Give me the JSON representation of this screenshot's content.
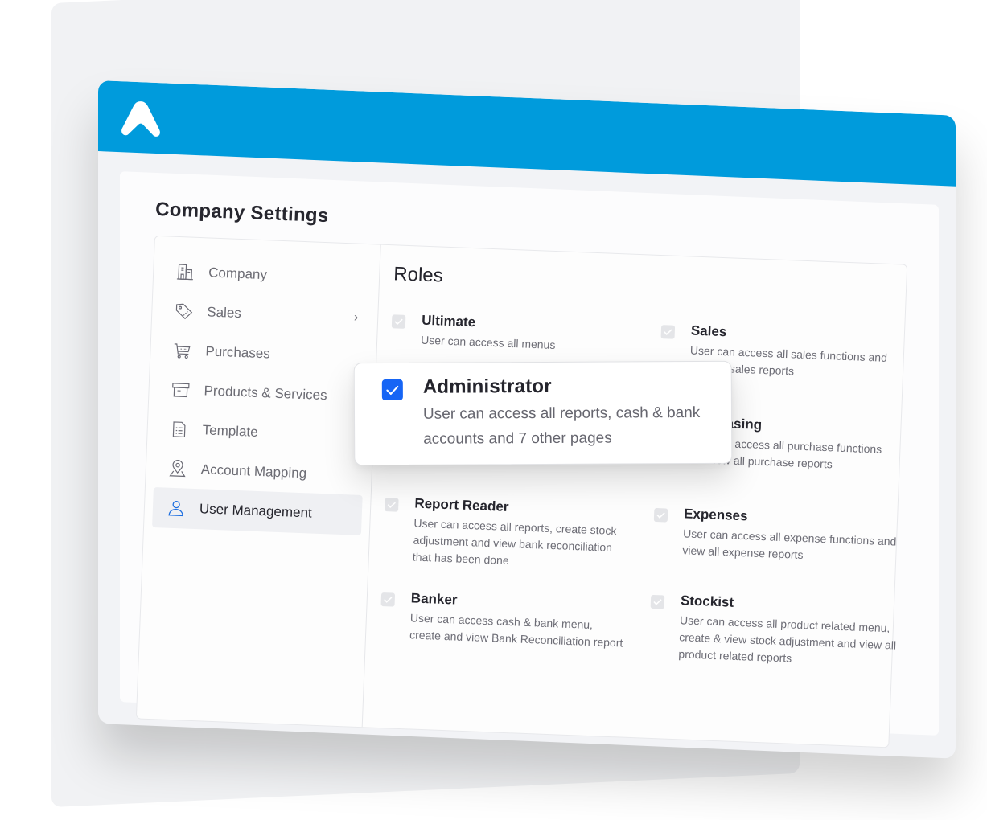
{
  "app": {
    "brand_color": "#009bdc",
    "logo_icon": "a-logo-icon"
  },
  "page": {
    "title": "Company Settings"
  },
  "sidebar": {
    "items": [
      {
        "label": "Company",
        "icon": "building-icon",
        "active": false
      },
      {
        "label": "Sales",
        "icon": "tag-icon",
        "active": false,
        "has_submenu": true
      },
      {
        "label": "Purchases",
        "icon": "cart-icon",
        "active": false
      },
      {
        "label": "Products & Services",
        "icon": "box-icon",
        "active": false
      },
      {
        "label": "Template",
        "icon": "document-icon",
        "active": false
      },
      {
        "label": "Account Mapping",
        "icon": "map-pin-icon",
        "active": false
      },
      {
        "label": "User Management",
        "icon": "user-icon",
        "active": true
      }
    ],
    "submenu_chevron": "›"
  },
  "roles": {
    "title": "Roles",
    "items": [
      {
        "name": "Ultimate",
        "description": "User can access all menus",
        "checked": true
      },
      {
        "name": "Sales",
        "description": "User can access all sales functions and view all sales reports",
        "checked": true
      },
      {
        "name": "Purchasing",
        "description": "User can access all purchase functions and view all purchase reports",
        "checked": true
      },
      {
        "name": "Report Reader",
        "description": "User can access all reports, create stock adjustment and view bank reconciliation that has been done",
        "checked": true
      },
      {
        "name": "Expenses",
        "description": "User can access all expense functions and view all expense reports",
        "checked": true
      },
      {
        "name": "Banker",
        "description": "User can access cash & bank menu, create and view Bank Reconciliation report",
        "checked": true
      },
      {
        "name": "Stockist",
        "description": "User can access all product related menu, create & view stock adjustment and view all product related reports",
        "checked": true
      }
    ]
  },
  "popup": {
    "name": "Administrator",
    "description": "User can access all reports, cash & bank accounts and 7 other pages",
    "checked": true,
    "checkbox_color": "#1665f5"
  }
}
